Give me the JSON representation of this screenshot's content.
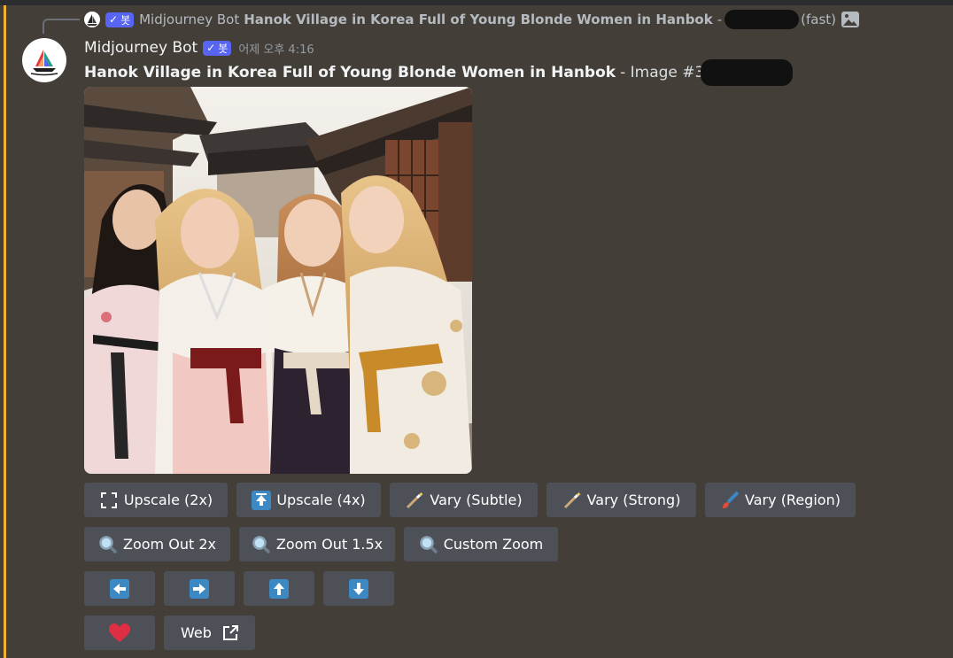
{
  "reply": {
    "bot_badge": "봇",
    "username": "Midjourney Bot",
    "prompt": "Hanok Village in Korea Full of Young Blonde Women in Hanbok",
    "dash": "-",
    "speed": "(fast)"
  },
  "message": {
    "username": "Midjourney Bot",
    "bot_badge": "봇",
    "timestamp": "어제 오후 4:16",
    "prompt": "Hanok Village in Korea Full of Young Blonde Women in Hanbok",
    "image_label": "- Image #3"
  },
  "buttons": {
    "row1": [
      {
        "label": "Upscale (2x)",
        "icon": "expand-corners-icon"
      },
      {
        "label": "Upscale (4x)",
        "icon": "up-arrow-box-icon"
      },
      {
        "label": "Vary (Subtle)",
        "icon": "magic-wand-icon"
      },
      {
        "label": "Vary (Strong)",
        "icon": "magic-wand-icon"
      },
      {
        "label": "Vary (Region)",
        "icon": "paintbrush-icon"
      }
    ],
    "row2": [
      {
        "label": "Zoom Out 2x",
        "icon": "magnifier-icon"
      },
      {
        "label": "Zoom Out 1.5x",
        "icon": "magnifier-icon"
      },
      {
        "label": "Custom Zoom",
        "icon": "magnifier-icon"
      }
    ],
    "row3": [
      {
        "icon": "arrow-left-icon"
      },
      {
        "icon": "arrow-right-icon"
      },
      {
        "icon": "arrow-up-icon"
      },
      {
        "icon": "arrow-down-icon"
      }
    ],
    "row4": [
      {
        "icon": "heart-icon"
      },
      {
        "label": "Web",
        "icon": "external-link-icon"
      }
    ]
  },
  "colors": {
    "background": "#433e37",
    "accent_bar": "#f0b232",
    "button_bg": "#4e5058",
    "bot_badge": "#5865f2",
    "arrow_icon": "#3b88c3",
    "heart": "#dd2e44"
  }
}
